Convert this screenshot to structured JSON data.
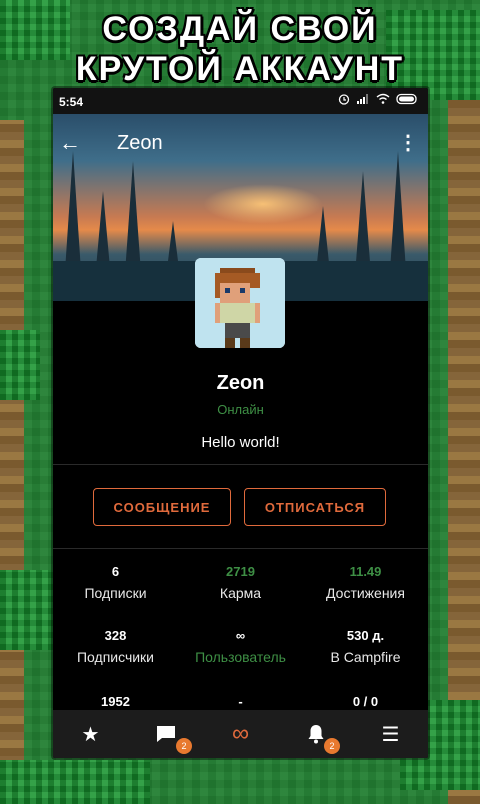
{
  "promo": {
    "line1": "СОЗДАЙ СВОЙ",
    "line2": "КРУТОЙ АККАУНТ"
  },
  "status_bar": {
    "time": "5:54",
    "icons": [
      "alarm-icon",
      "signal-icon",
      "wifi-icon",
      "battery-icon"
    ]
  },
  "header": {
    "back_icon": "arrow-left-icon",
    "title": "Zeon",
    "menu_icon": "more-vertical-icon"
  },
  "profile": {
    "name": "Zeon",
    "status": "Онлайн",
    "bio": "Hello world!"
  },
  "actions": {
    "message": "СООБЩЕНИЕ",
    "unfollow": "ОТПИСАТЬСЯ"
  },
  "stats": [
    {
      "value": "6",
      "label": "Подписки"
    },
    {
      "value": "2719",
      "label": "Карма"
    },
    {
      "value": "11.49",
      "label": "Достижения"
    },
    {
      "value": "328",
      "label": "Подписчики"
    },
    {
      "value": "∞",
      "label": "Пользователь"
    },
    {
      "value": "530 д.",
      "label": "В Campfire"
    },
    {
      "value": "1952",
      "label": ""
    },
    {
      "value": "-",
      "label": ""
    },
    {
      "value": "0 / 0",
      "label": ""
    }
  ],
  "bottom_nav": {
    "items": [
      "star-icon",
      "chat-icon",
      "infinity-icon",
      "bell-icon",
      "menu-icon"
    ],
    "chat_badge": "2",
    "bell_badge": "2"
  },
  "colors": {
    "accent": "#e06a3c",
    "online_green": "#3e8f45",
    "background": "#000000",
    "nav_bg": "#1c1c1c"
  }
}
